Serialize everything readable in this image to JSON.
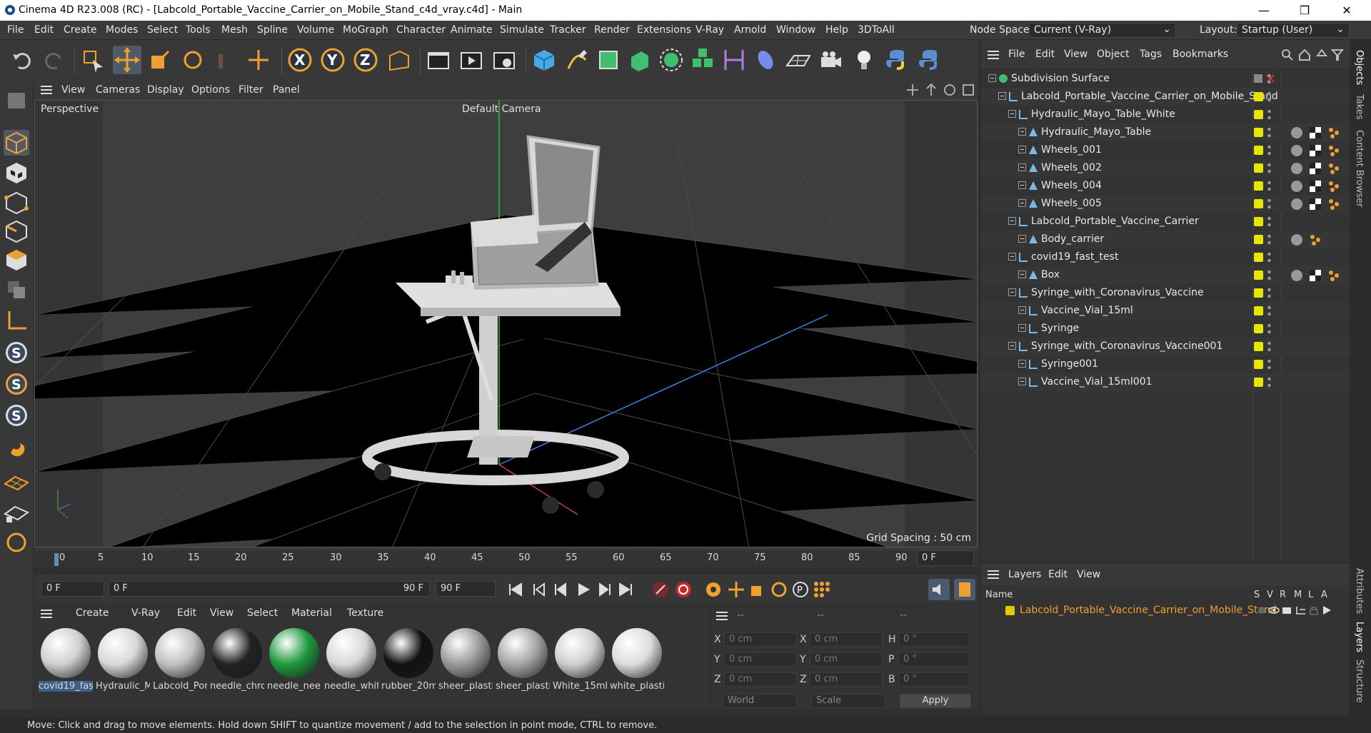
{
  "window": {
    "title": "Cinema 4D R23.008 (RC) - [Labcold_Portable_Vaccine_Carrier_on_Mobile_Stand_c4d_vray.c4d] - Main"
  },
  "menu": [
    "File",
    "Edit",
    "Create",
    "Modes",
    "Select",
    "Tools",
    "Mesh",
    "Spline",
    "Volume",
    "MoGraph",
    "Character",
    "Animate",
    "Simulate",
    "Tracker",
    "Render",
    "Extensions",
    "V-Ray",
    "Arnold",
    "Window",
    "Help",
    "3DToAll"
  ],
  "nodespace": {
    "label": "Node Space:",
    "value": "Current (V-Ray)"
  },
  "layout": {
    "label": "Layout:",
    "value": "Startup (User)"
  },
  "viewport": {
    "menu": [
      "View",
      "Cameras",
      "Display",
      "Options",
      "Filter",
      "Panel"
    ],
    "label": "Perspective",
    "camera": "Default Camera",
    "grid": "Grid Spacing : 50 cm"
  },
  "timeline": {
    "ticks": [
      "0",
      "5",
      "10",
      "15",
      "20",
      "25",
      "30",
      "35",
      "40",
      "45",
      "50",
      "55",
      "60",
      "65",
      "70",
      "75",
      "80",
      "85",
      "90"
    ],
    "current": "0 F"
  },
  "transport": {
    "start": "0 F",
    "range_start": "0 F",
    "range_end": "90 F",
    "end": "90 F"
  },
  "materials": {
    "menu": [
      "Create",
      "V-Ray",
      "Edit",
      "View",
      "Select",
      "Material",
      "Texture"
    ],
    "items": [
      {
        "label": "covid19_fas",
        "color": "#d0d0d0"
      },
      {
        "label": "Hydraulic_M",
        "color": "#d8d8d8"
      },
      {
        "label": "Labcold_Por",
        "color": "#c0c0c0"
      },
      {
        "label": "needle_chrc",
        "color": "#222222"
      },
      {
        "label": "needle_nee",
        "color": "#1e9a3e"
      },
      {
        "label": "needle_whit",
        "color": "#d8d8d8"
      },
      {
        "label": "rubber_20m",
        "color": "#111111"
      },
      {
        "label": "sheer_plasti",
        "color": "#9a9a9a"
      },
      {
        "label": "sheer_plasti",
        "color": "#a6a6a6"
      },
      {
        "label": "White_15ml",
        "color": "#cfcfcf"
      },
      {
        "label": "white_plasti",
        "color": "#dcdcdc"
      }
    ]
  },
  "attributes": {
    "headers": [
      "--",
      "--",
      "--"
    ],
    "x": "0 cm",
    "y": "0 cm",
    "z": "0 cm",
    "x2": "0 cm",
    "y2": "0 cm",
    "z2": "0 cm",
    "h": "0 °",
    "p": "0 °",
    "b": "0 °",
    "labels": {
      "X": "X",
      "Y": "Y",
      "Z": "Z",
      "H": "H",
      "P": "P",
      "B": "B"
    },
    "world": "World",
    "scale": "Scale",
    "apply": "Apply"
  },
  "objects": {
    "menu": [
      "File",
      "Edit",
      "View",
      "Object",
      "Tags",
      "Bookmarks"
    ],
    "rows": [
      {
        "name": "Subdivision Surface",
        "indent": 0,
        "tags": 0
      },
      {
        "name": "Labcold_Portable_Vaccine_Carrier_on_Mobile_Stand",
        "indent": 1,
        "tags": 0
      },
      {
        "name": "Hydraulic_Mayo_Table_White",
        "indent": 2,
        "tags": 0
      },
      {
        "name": "Hydraulic_Mayo_Table",
        "indent": 3,
        "tags": 3
      },
      {
        "name": "Wheels_001",
        "indent": 3,
        "tags": 3
      },
      {
        "name": "Wheels_002",
        "indent": 3,
        "tags": 3
      },
      {
        "name": "Wheels_004",
        "indent": 3,
        "tags": 3
      },
      {
        "name": "Wheels_005",
        "indent": 3,
        "tags": 3
      },
      {
        "name": "Labcold_Portable_Vaccine_Carrier",
        "indent": 2,
        "tags": 0
      },
      {
        "name": "Body_carrier",
        "indent": 3,
        "tags": 2
      },
      {
        "name": "covid19_fast_test",
        "indent": 2,
        "tags": 0
      },
      {
        "name": "Box",
        "indent": 3,
        "tags": 3
      },
      {
        "name": "Syringe_with_Coronavirus_Vaccine",
        "indent": 2,
        "tags": 0
      },
      {
        "name": "Vaccine_Vial_15ml",
        "indent": 3,
        "tags": 0
      },
      {
        "name": "Syringe",
        "indent": 3,
        "tags": 0
      },
      {
        "name": "Syringe_with_Coronavirus_Vaccine001",
        "indent": 2,
        "tags": 0
      },
      {
        "name": "Syringe001",
        "indent": 3,
        "tags": 0
      },
      {
        "name": "Vaccine_Vial_15ml001",
        "indent": 3,
        "tags": 0
      }
    ]
  },
  "layers": {
    "menu": [
      "Layers",
      "Edit",
      "View"
    ],
    "col_name": "Name",
    "cols": [
      "S",
      "V",
      "R",
      "M",
      "L",
      "A"
    ],
    "row": "Labcold_Portable_Vaccine_Carrier_on_Mobile_Stand"
  },
  "side_tabs": [
    "Objects",
    "Takes",
    "Content Browser",
    "Attributes",
    "Layers",
    "Structure"
  ],
  "status": "Move: Click and drag to move elements. Hold down SHIFT to quantize movement / add to the selection in point mode, CTRL to remove."
}
